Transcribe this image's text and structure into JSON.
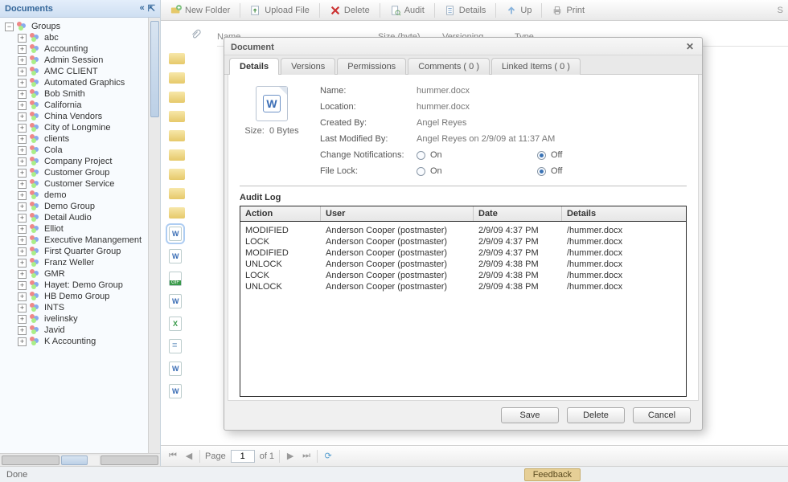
{
  "sidebar": {
    "title": "Documents",
    "collapse_glyph": "«",
    "root": {
      "label": "Groups",
      "expander": "−"
    },
    "items": [
      {
        "label": "abc"
      },
      {
        "label": "Accounting"
      },
      {
        "label": "Admin Session"
      },
      {
        "label": "AMC CLIENT"
      },
      {
        "label": "Automated Graphics"
      },
      {
        "label": "Bob Smith"
      },
      {
        "label": "California"
      },
      {
        "label": "China Vendors"
      },
      {
        "label": "City of Longmine"
      },
      {
        "label": "clients"
      },
      {
        "label": "Cola"
      },
      {
        "label": "Company Project"
      },
      {
        "label": "Customer Group"
      },
      {
        "label": "Customer Service"
      },
      {
        "label": "demo"
      },
      {
        "label": "Demo Group"
      },
      {
        "label": "Detail Audio"
      },
      {
        "label": "Elliot"
      },
      {
        "label": "Executive Manangement"
      },
      {
        "label": "First Quarter Group"
      },
      {
        "label": "Franz Weller"
      },
      {
        "label": "GMR"
      },
      {
        "label": "Hayet: Demo Group"
      },
      {
        "label": "HB Demo Group"
      },
      {
        "label": "INTS"
      },
      {
        "label": "ivelinsky"
      },
      {
        "label": "Javid"
      },
      {
        "label": "K Accounting"
      }
    ]
  },
  "toolbar": {
    "new_folder": "New Folder",
    "upload": "Upload File",
    "delete": "Delete",
    "audit": "Audit",
    "details": "Details",
    "up": "Up",
    "print": "Print",
    "right_s": "S"
  },
  "grid_headers": {
    "name": "Name",
    "size": "Size (byte)",
    "versioning": "Versioning",
    "type": "Type"
  },
  "pager": {
    "page_label": "Page",
    "page_value": "1",
    "of_label": "of 1"
  },
  "status": {
    "text": "Done",
    "feedback": "Feedback"
  },
  "dialog": {
    "title": "Document",
    "tabs": {
      "details": "Details",
      "versions": "Versions",
      "permissions": "Permissions",
      "comments": "Comments ( 0 )",
      "linked": "Linked Items ( 0 )"
    },
    "thumb": {
      "size_label": "Size:",
      "size_value": "0 Bytes"
    },
    "meta": {
      "name_label": "Name:",
      "name_value": "hummer.docx",
      "location_label": "Location:",
      "location_value": "hummer.docx",
      "created_label": "Created By:",
      "created_value": "Angel  Reyes",
      "modified_label": "Last Modified By:",
      "modified_value": "Angel  Reyes on 2/9/09 at 11:37 AM",
      "notif_label": "Change Notifications:",
      "lock_label": "File Lock:",
      "on": "On",
      "off": "Off"
    },
    "audit": {
      "title": "Audit Log",
      "cols": {
        "action": "Action",
        "user": "User",
        "date": "Date",
        "details": "Details"
      },
      "rows": [
        {
          "action": "MODIFIED",
          "user": "Anderson Cooper (postmaster)",
          "date": "2/9/09 4:37 PM",
          "details": "/hummer.docx"
        },
        {
          "action": "LOCK",
          "user": "Anderson Cooper (postmaster)",
          "date": "2/9/09 4:37 PM",
          "details": "/hummer.docx"
        },
        {
          "action": "MODIFIED",
          "user": "Anderson Cooper (postmaster)",
          "date": "2/9/09 4:37 PM",
          "details": "/hummer.docx"
        },
        {
          "action": "UNLOCK",
          "user": "Anderson Cooper (postmaster)",
          "date": "2/9/09 4:38 PM",
          "details": "/hummer.docx"
        },
        {
          "action": "LOCK",
          "user": "Anderson Cooper (postmaster)",
          "date": "2/9/09 4:38 PM",
          "details": "/hummer.docx"
        },
        {
          "action": "UNLOCK",
          "user": "Anderson Cooper (postmaster)",
          "date": "2/9/09 4:38 PM",
          "details": "/hummer.docx"
        }
      ]
    },
    "buttons": {
      "save": "Save",
      "delete": "Delete",
      "cancel": "Cancel"
    }
  },
  "colors": {
    "accent_blue": "#336699",
    "panel_bg": "#f0f0f0",
    "feedback_bg": "#e6cf96"
  }
}
